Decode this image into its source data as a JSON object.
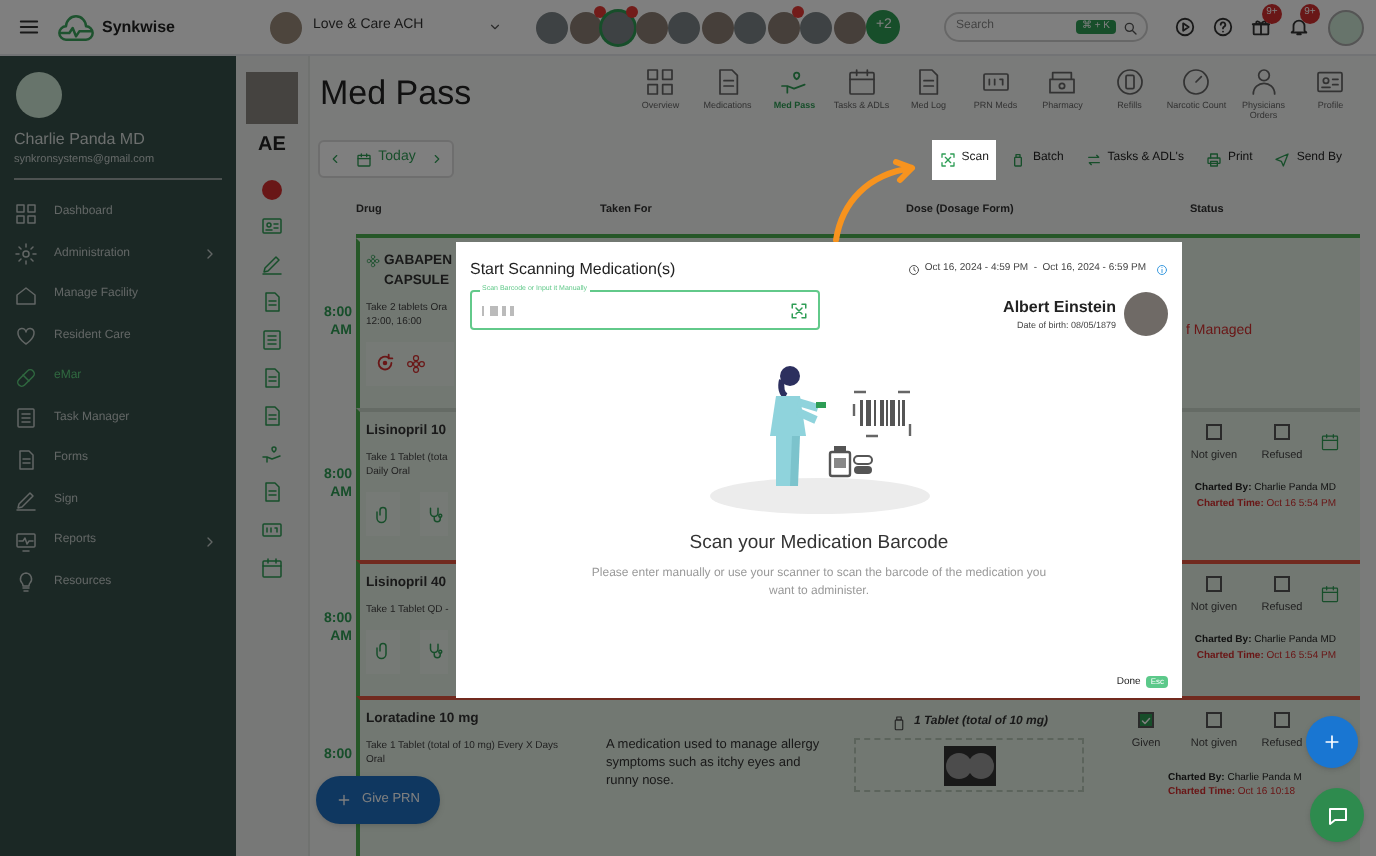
{
  "app": {
    "name": "Synkwise"
  },
  "facility": {
    "name": "Love & Care ACH"
  },
  "staff_avatars": [
    {
      "alert": false,
      "selected": false
    },
    {
      "alert": true,
      "selected": false
    },
    {
      "alert": true,
      "selected": true
    },
    {
      "alert": false,
      "selected": false
    },
    {
      "alert": false,
      "selected": false
    },
    {
      "alert": false,
      "selected": false
    },
    {
      "alert": false,
      "selected": false
    },
    {
      "alert": true,
      "selected": false
    },
    {
      "alert": false,
      "selected": false
    },
    {
      "alert": false,
      "selected": false
    }
  ],
  "more_staff": "+2",
  "search": {
    "placeholder": "Search",
    "shortcut": "⌘ + K"
  },
  "header_badges": [
    "9+",
    "9+"
  ],
  "user": {
    "name": "Charlie Panda MD",
    "email": "synkronsystems@gmail.com"
  },
  "sidebar": {
    "items": [
      {
        "label": "Dashboard",
        "selected": false,
        "expandable": false
      },
      {
        "label": "Administration",
        "selected": false,
        "expandable": true
      },
      {
        "label": "Manage Facility",
        "selected": false,
        "expandable": false
      },
      {
        "label": "Resident Care",
        "selected": false,
        "expandable": false
      },
      {
        "label": "eMar",
        "selected": true,
        "expandable": false
      },
      {
        "label": "Task Manager",
        "selected": false,
        "expandable": false
      },
      {
        "label": "Forms",
        "selected": false,
        "expandable": false
      },
      {
        "label": "Sign",
        "selected": false,
        "expandable": false
      },
      {
        "label": "Reports",
        "selected": false,
        "expandable": true
      },
      {
        "label": "Resources",
        "selected": false,
        "expandable": false
      }
    ]
  },
  "resident": {
    "initials": "AE"
  },
  "page_title": "Med Pass",
  "tabs": [
    {
      "label": "Overview",
      "selected": false
    },
    {
      "label": "Medications",
      "selected": false
    },
    {
      "label": "Med Pass",
      "selected": true
    },
    {
      "label": "Tasks & ADLs",
      "selected": false
    },
    {
      "label": "Med Log",
      "selected": false
    },
    {
      "label": "PRN Meds",
      "selected": false
    },
    {
      "label": "Pharmacy",
      "selected": false
    },
    {
      "label": "Refills",
      "selected": false
    },
    {
      "label": "Narcotic Count",
      "selected": false
    },
    {
      "label": "Physicians Orders",
      "selected": false
    },
    {
      "label": "Profile",
      "selected": false
    }
  ],
  "date_nav": {
    "label": "Today"
  },
  "actions": [
    {
      "label": "Scan",
      "highlighted": true
    },
    {
      "label": "Batch",
      "highlighted": false
    },
    {
      "label": "Tasks & ADL's",
      "highlighted": false
    },
    {
      "label": "Print",
      "highlighted": false
    },
    {
      "label": "Send By",
      "highlighted": false
    }
  ],
  "table": {
    "columns": [
      "Drug",
      "Taken For",
      "Dose (Dosage Form)",
      "Status"
    ],
    "rows": [
      {
        "time": "8:00 AM",
        "alert_line": false,
        "drug": "GABAPEN",
        "drug_line2": "CAPSULE",
        "instructions": [
          "Take 2 tablets Ora",
          "12:00, 16:00"
        ],
        "status": {
          "kind": "note",
          "text": "f Managed"
        }
      },
      {
        "time": "8:00 AM",
        "alert_line": false,
        "drug": "Lisinopril 10",
        "instructions": [
          "Take 1 Tablet (tota",
          "Daily Oral"
        ],
        "status": {
          "kind": "checks",
          "options": [
            {
              "label": "Not given",
              "checked": false
            },
            {
              "label": "Refused",
              "checked": false
            }
          ],
          "charted_by": "**Charted By:** Charlie Panda MD",
          "charted_time": "**Charted Time:** Oct 16 5:54 PM"
        }
      },
      {
        "time": "8:00 AM",
        "alert_line": true,
        "drug": "Lisinopril 40",
        "instructions": [
          "Take 1 Tablet QD -"
        ],
        "status": {
          "kind": "checks",
          "options": [
            {
              "label": "Not given",
              "checked": false
            },
            {
              "label": "Refused",
              "checked": false
            }
          ],
          "charted_by": "**Charted By:** Charlie Panda MD",
          "charted_time": "**Charted Time:** Oct 16 5:54 PM"
        }
      },
      {
        "time": "8:00",
        "alert_line": true,
        "drug": "Loratadine 10 mg",
        "instructions": [
          "Take 1 Tablet (total of 10 mg) Every X Days",
          "Oral"
        ],
        "taken_for": "A medication used to manage allergy symptoms such as itchy eyes and runny nose.",
        "dose": "1 Tablet (total of 10 mg)",
        "status": {
          "kind": "checks",
          "options": [
            {
              "label": "Given",
              "checked": true
            },
            {
              "label": "Not given",
              "checked": false
            },
            {
              "label": "Refused",
              "checked": false
            }
          ],
          "charted_by": "**Charted By:** Charlie Panda M",
          "charted_time": "**Charted Time:** Oct 16 10:18"
        }
      }
    ]
  },
  "give_prn": "Give PRN",
  "modal": {
    "title": "Start Scanning Medication(s)",
    "time_range": "Oct 16, 2024 - 4:59 PM  -  Oct 16, 2024 - 6:59 PM",
    "field_label": "Scan Barcode or Input it Manually",
    "resident_name": "Albert Einstein",
    "birth_date": "Date of birth: 08/05/1879",
    "heading": "Scan your Medication Barcode",
    "message": "Please enter manually or use your scanner to scan the barcode of the medication you want to administer.",
    "done": "Done",
    "shortcut": "Esc"
  }
}
